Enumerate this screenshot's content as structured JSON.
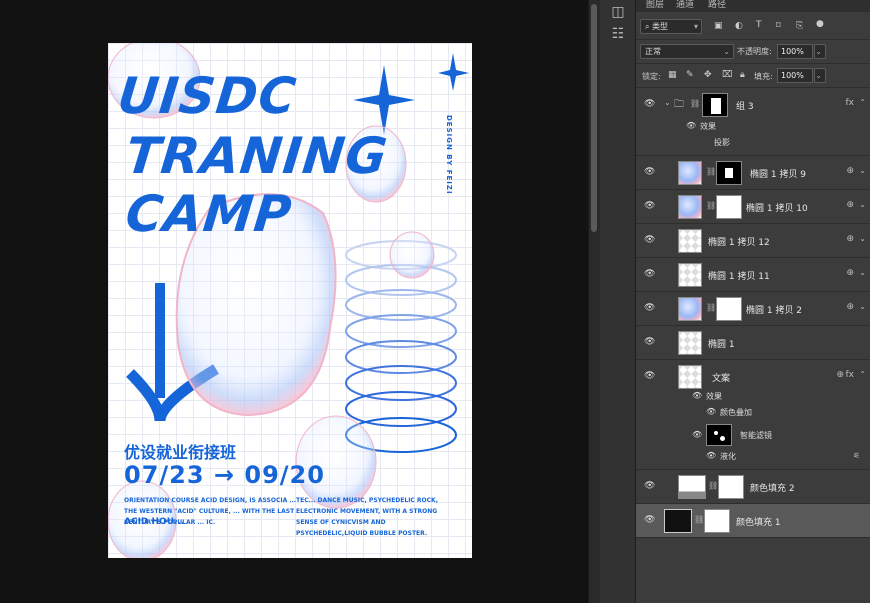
{
  "poster": {
    "title_line1": "UISDC",
    "title_line2": "TRANING",
    "title_line3": "CAMP",
    "side_text": "DESIGN BY FEIZI",
    "cn_title": "优设就业衔接班",
    "date": "07/23 → 09/20",
    "desc_left": "ORIENTATION COURSE ACID DESIGN, IS ASSOCIA  ... THE WESTERN \"ACID\" CULTURE, ... WITH THE LAST CENTURY'S POPULAR ... IC.",
    "desc_right": "TEC... DANCE MUSIC, PSYCHEDELIC ROCK, ELECTRONIC MOVEMENT, WITH A STRONG SENSE OF CYNICVISM AND PSYCHEDELIC,LIQUID BUBBLE POSTER.",
    "acid_tag": "ACID HOU..."
  },
  "panel": {
    "tabs": [
      "图层",
      "通道",
      "路径"
    ],
    "filter_label": "类型",
    "blend_mode": "正常",
    "opacity_label": "不透明度:",
    "opacity_value": "100%",
    "lock_label": "锁定:",
    "fill_label": "填充:",
    "fill_value": "100%"
  },
  "layers": {
    "group3": {
      "name": "组 3",
      "fx": "fx",
      "effects_label": "效果",
      "shadow_label": "投影"
    },
    "ellipse9": {
      "name": "椭圆 1 拷贝 9"
    },
    "ellipse10": {
      "name": "椭圆 1 拷贝 10"
    },
    "ellipse12": {
      "name": "椭圆 1 拷贝 12"
    },
    "ellipse11": {
      "name": "椭圆 1 拷贝 11"
    },
    "ellipse2": {
      "name": "椭圆 1 拷贝 2"
    },
    "ellipse1": {
      "name": "椭圆 1"
    },
    "text": {
      "name": "文案",
      "fx": "fx",
      "effects_label": "效果",
      "color_overlay": "颜色叠加",
      "smart_filter": "智能滤镜",
      "liquify": "液化"
    },
    "fill2": {
      "name": "颜色填充 2"
    },
    "fill1": {
      "name": "颜色填充 1"
    }
  },
  "colors": {
    "accent_blue": "#1565d8",
    "panel_bg": "#3c3c3c",
    "selected_row": "#595959"
  }
}
